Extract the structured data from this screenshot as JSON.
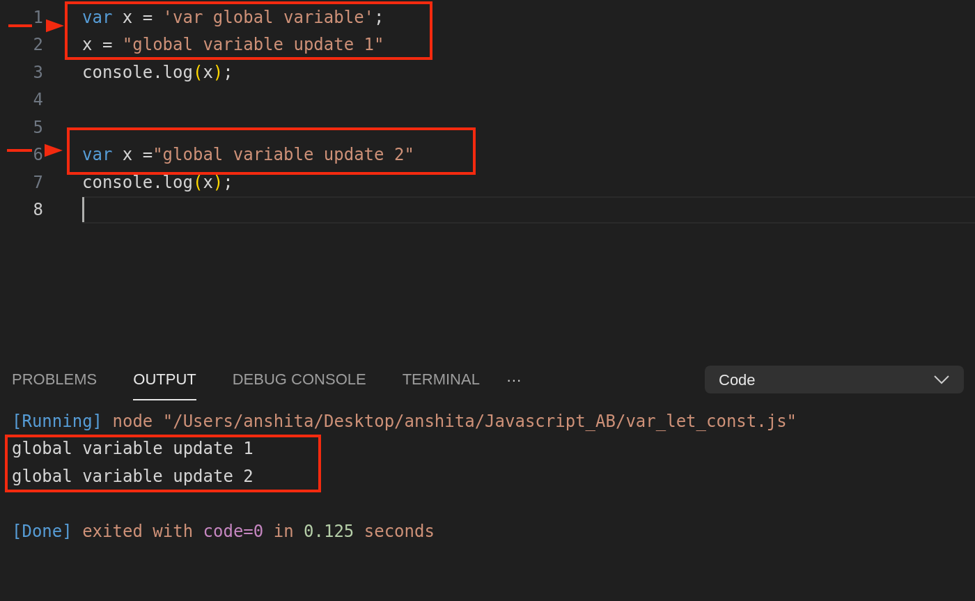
{
  "editor": {
    "lines": [
      {
        "number": "1",
        "current": false,
        "tokens": [
          {
            "text": "var",
            "kind": "keyword"
          },
          {
            "text": " x = ",
            "kind": "plain"
          },
          {
            "text": "'var global variable'",
            "kind": "string"
          },
          {
            "text": ";",
            "kind": "plain"
          }
        ]
      },
      {
        "number": "2",
        "current": false,
        "tokens": [
          {
            "text": "x = ",
            "kind": "plain"
          },
          {
            "text": "\"global variable update 1\"",
            "kind": "string"
          }
        ]
      },
      {
        "number": "3",
        "current": false,
        "tokens": [
          {
            "text": "console.log",
            "kind": "plain"
          },
          {
            "text": "(",
            "kind": "bracket"
          },
          {
            "text": "x",
            "kind": "plain"
          },
          {
            "text": ")",
            "kind": "bracket"
          },
          {
            "text": ";",
            "kind": "plain"
          }
        ]
      },
      {
        "number": "4",
        "current": false
      },
      {
        "number": "5",
        "current": false
      },
      {
        "number": "6",
        "current": false,
        "tokens": [
          {
            "text": "var",
            "kind": "keyword"
          },
          {
            "text": " x =",
            "kind": "plain"
          },
          {
            "text": "\"global variable update 2\"",
            "kind": "string"
          }
        ]
      },
      {
        "number": "7",
        "current": false,
        "tokens": [
          {
            "text": "console.log",
            "kind": "plain"
          },
          {
            "text": "(",
            "kind": "bracket"
          },
          {
            "text": "x",
            "kind": "plain"
          },
          {
            "text": ")",
            "kind": "bracket"
          },
          {
            "text": ";",
            "kind": "plain"
          }
        ]
      },
      {
        "number": "8",
        "current": true
      }
    ]
  },
  "panel": {
    "tabs": [
      {
        "label": "PROBLEMS",
        "selected": false
      },
      {
        "label": "OUTPUT",
        "selected": true
      },
      {
        "label": "DEBUG CONSOLE",
        "selected": false
      },
      {
        "label": "TERMINAL",
        "selected": false
      }
    ],
    "more": "···",
    "dropdown": {
      "value": "Code"
    },
    "output": [
      {
        "kind": "text",
        "tokens": [
          {
            "text": "[Running]",
            "kind": "keyword"
          },
          {
            "text": " node \"/Users/anshita/Desktop/anshita/Javascript_AB/var_let_const.js\"",
            "kind": "string"
          }
        ]
      },
      {
        "kind": "text",
        "tokens": [
          {
            "text": "global variable update 1",
            "kind": "plain"
          }
        ]
      },
      {
        "kind": "text",
        "tokens": [
          {
            "text": "global variable update 2",
            "kind": "plain"
          }
        ]
      },
      {
        "kind": "blank"
      },
      {
        "kind": "text",
        "tokens": [
          {
            "text": "[Done]",
            "kind": "keyword"
          },
          {
            "text": " exited with ",
            "kind": "string"
          },
          {
            "text": "code=0",
            "kind": "purple"
          },
          {
            "text": " in ",
            "kind": "string"
          },
          {
            "text": "0.125",
            "kind": "number"
          },
          {
            "text": " seconds",
            "kind": "string"
          }
        ]
      }
    ]
  }
}
